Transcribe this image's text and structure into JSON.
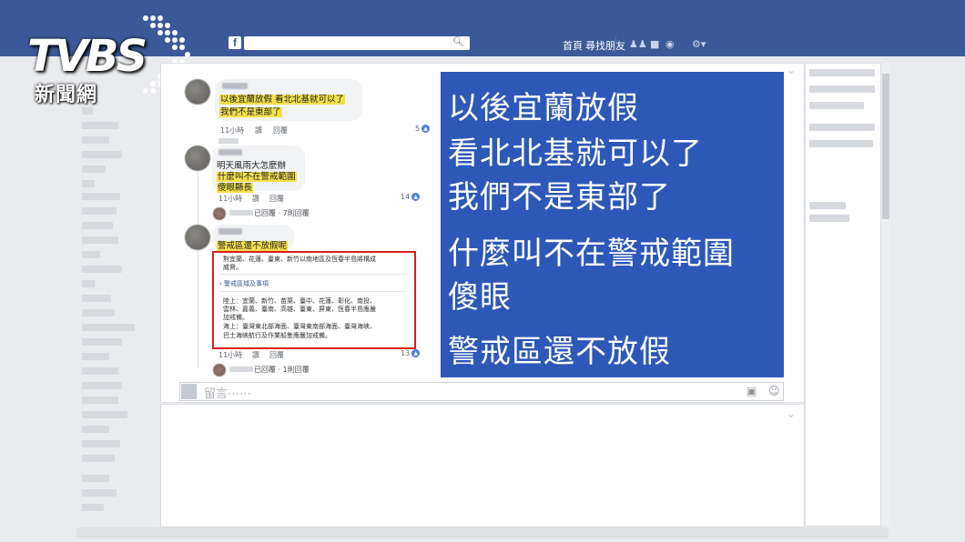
{
  "brand": {
    "logo_main": "TVBS",
    "logo_sub": "新聞網"
  },
  "topbar": {
    "fb_icon": "f",
    "search_icon": "search-icon",
    "nav_home": "首頁",
    "nav_find_friends": "尋找朋友",
    "friends_icon": "friends-icon",
    "messages_icon": "messages-icon",
    "globe_icon": "globe-icon",
    "settings_icon": "settings-icon"
  },
  "comments": [
    {
      "lines": [
        "以後宜蘭放假 看北北基就可以了",
        "我們不是東部了"
      ],
      "time": "11小時",
      "like": "讚",
      "reply": "回覆",
      "likes": "5"
    },
    {
      "lines": [
        "明天風雨大怎麼辦",
        "什麼叫不在警戒範圍",
        "傻眼縣長"
      ],
      "time": "11小時",
      "like": "讚",
      "reply": "回覆",
      "likes": "14",
      "reply_summary": "已回覆 · 7則回覆"
    },
    {
      "lines": [
        "警戒區還不放假呢"
      ],
      "time": "11小時",
      "like": "讚",
      "reply": "回覆",
      "likes": "13",
      "reply_summary": "已回覆 · 1則回覆",
      "attachment": {
        "intro_1": "對宜蘭、花蓮、臺東、新竹以南地區及恆春半島將構成",
        "intro_2": "威脅。",
        "link": "警戒區域及事項",
        "land_1": "陸上：宜蘭、新竹、苗栗、臺中、花蓮、彰化、南投、",
        "land_2": "雲林、嘉義、臺南、高雄、臺東、屏東、恆春半島應嚴",
        "land_3": "加戒備。",
        "sea_1": "海上：臺灣東北部海面、臺灣東南部海面、臺灣海峽、",
        "sea_2": "巴士海峽航行及作業船隻應嚴加戒備。"
      }
    }
  ],
  "overlay": {
    "lines": [
      "以後宜蘭放假",
      "看北北基就可以了",
      "我們不是東部了",
      "什麼叫不在警戒範圍",
      "傻眼",
      "警戒區還不放假"
    ]
  },
  "composer": {
    "placeholder": "留言⋯⋯",
    "camera_icon": "camera-icon",
    "emoji_icon": "emoji-icon"
  },
  "colors": {
    "facebook_blue": "#3b5998",
    "overlay_blue": "#2d58b8",
    "highlight": "#f4e04d",
    "red_box": "#d81e1e"
  }
}
